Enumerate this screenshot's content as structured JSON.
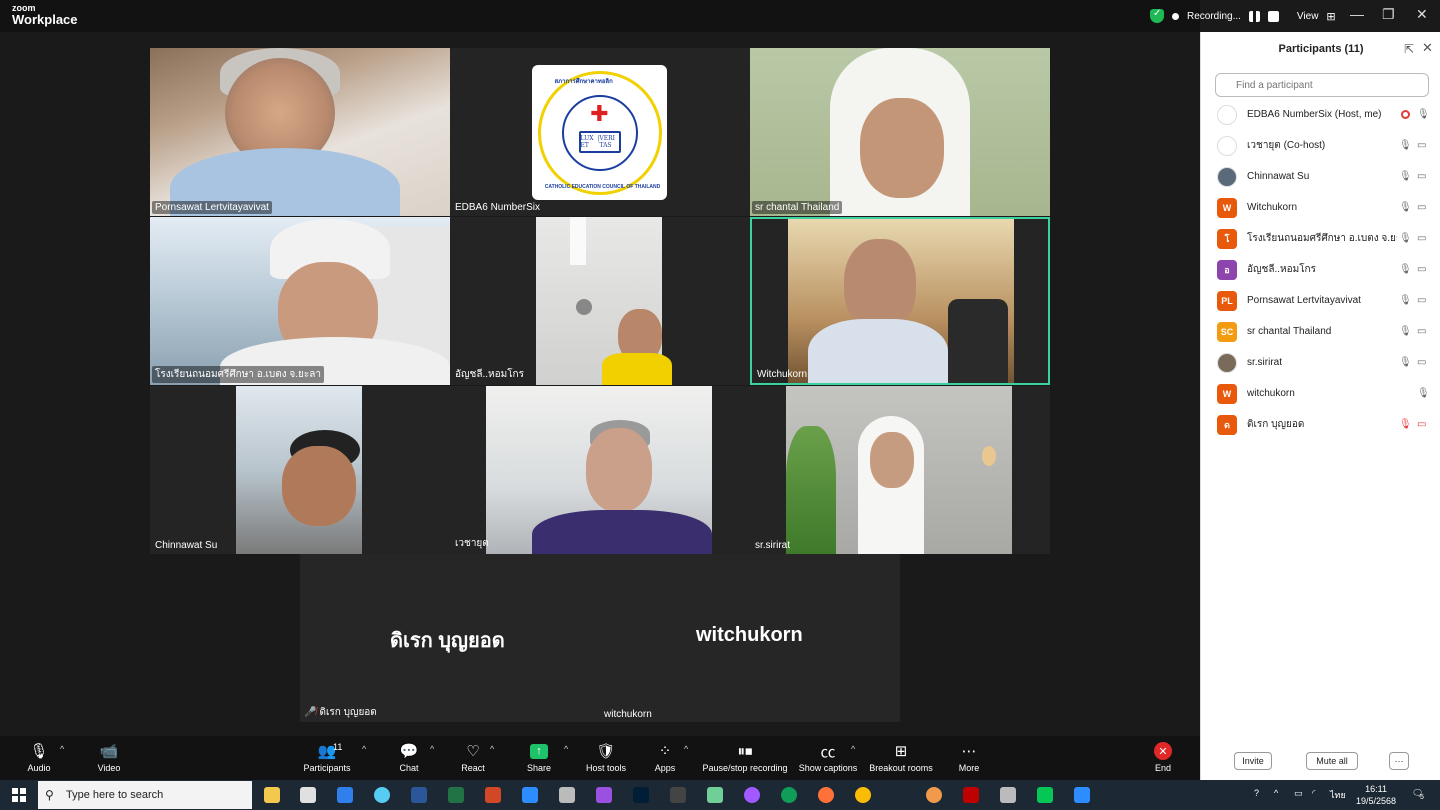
{
  "window": {
    "brand_top": "zoom",
    "brand_bottom": "Workplace",
    "recording_label": "Recording...",
    "view_label": "View"
  },
  "tiles": {
    "pornsawat": "Pornsawat Lertvitayavivat",
    "edba6": "EDBA6 NumberSix",
    "chantal": "sr chantal Thailand",
    "school": "โรงเรียนถนอมศรีศึกษา อ.เบตง จ.ยะลา",
    "anchali": "อัญชลี..หอมโกร",
    "witchukorn": "Witchukorn",
    "chinnawat": "Chinnawat Su",
    "wechayut": "เวชายุต",
    "sirirat": "sr.sirirat"
  },
  "logo": {
    "arc_text": "CATHOLIC EDUCATION COUNCIL OF THAILAND",
    "top_text": "สภาการศึกษาคาทอลิก",
    "book_left": "LUX ET",
    "book_right": "VERI TAS"
  },
  "audio_tile": {
    "person1_big": "ดิเรก บุญยอด",
    "person1_small": "ดิเรก บุญยอด",
    "person2_big": "witchukorn",
    "person2_small": "witchukorn"
  },
  "toolbar": {
    "audio": "Audio",
    "video": "Video",
    "participants": "Participants",
    "participants_count": "11",
    "chat": "Chat",
    "react": "React",
    "share": "Share",
    "host_tools": "Host tools",
    "apps": "Apps",
    "pause_recording": "Pause/stop recording",
    "captions": "Show captions",
    "breakout": "Breakout rooms",
    "more": "More",
    "end": "End"
  },
  "panel": {
    "title": "Participants (11)",
    "search_placeholder": "Find a participant",
    "invite": "Invite",
    "mute_all": "Mute all",
    "more": "···",
    "participants": [
      {
        "name": "EDBA6 NumberSix (Host, me)",
        "avatar": "",
        "color": "#ffffff"
      },
      {
        "name": "เวชายุต (Co-host)",
        "avatar": "",
        "color": "#ffffff"
      },
      {
        "name": "Chinnawat Su",
        "avatar": "",
        "color": "#5a6a7a"
      },
      {
        "name": "Witchukorn",
        "avatar": "W",
        "color": "#e8590c"
      },
      {
        "name": "โรงเรียนถนอมศรีศึกษา อ.เบตง จ.ยะลา",
        "avatar": "โ",
        "color": "#e8590c"
      },
      {
        "name": "อัญชลี..หอมโกร",
        "avatar": "อ",
        "color": "#8e44ad"
      },
      {
        "name": "Pornsawat Lertvitayavivat",
        "avatar": "PL",
        "color": "#e8590c"
      },
      {
        "name": "sr chantal Thailand",
        "avatar": "SC",
        "color": "#f39c12"
      },
      {
        "name": "sr.sirirat",
        "avatar": "",
        "color": "#7a6a5a"
      },
      {
        "name": "witchukorn",
        "avatar": "W",
        "color": "#e8590c"
      },
      {
        "name": "ดิเรก บุญยอด",
        "avatar": "ด",
        "color": "#e8590c"
      }
    ]
  },
  "taskbar": {
    "search_placeholder": "Type here to search",
    "time": "16:11",
    "date": "19/5/2568",
    "lang": "ไทย",
    "notif": "5"
  },
  "colors": {
    "active_speaker": "#3bd1a0",
    "end_red": "#e02828",
    "share_green": "#1ec26a"
  }
}
